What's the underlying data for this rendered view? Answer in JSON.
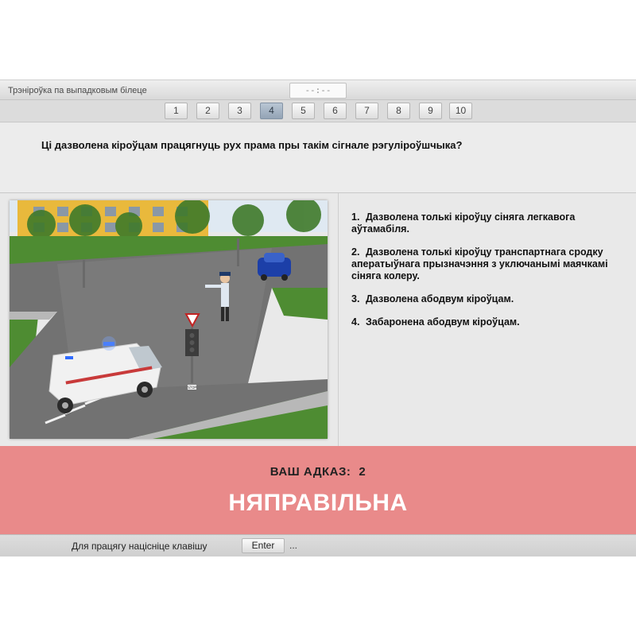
{
  "header": {
    "title": "Трэніроўка па выпадковым білеце",
    "timer": "--:--"
  },
  "nav": {
    "questions": [
      "1",
      "2",
      "3",
      "4",
      "5",
      "6",
      "7",
      "8",
      "9",
      "10"
    ],
    "active": "4"
  },
  "question": {
    "text": "Ці дазволена кіроўцам працягнуць рух прама пры такім сігнале рэгуліроўшчыка?"
  },
  "picture": {
    "sign_label": "STOP"
  },
  "answers": [
    {
      "num": "1.",
      "text": "Дазволена толькі кіроўцу сіняга легкавога аўтамабіля."
    },
    {
      "num": "2.",
      "text": "Дазволена толькі кіроўцу транспартнага сродку аператыўнага прызначэння з уключанымі маячкамі сіняга колеру."
    },
    {
      "num": "3.",
      "text": "Дазволена абодвум кіроўцам."
    },
    {
      "num": "4.",
      "text": "Забаронена абодвум кіроўцам."
    }
  ],
  "result": {
    "label": "ВАШ АДКАЗ:",
    "value": "2",
    "verdict": "НЯПРАВІЛЬНА",
    "background": "#e98a8a"
  },
  "footer": {
    "hint": "Для працягу націсніце клавішу",
    "key": "Enter",
    "suffix": "..."
  }
}
